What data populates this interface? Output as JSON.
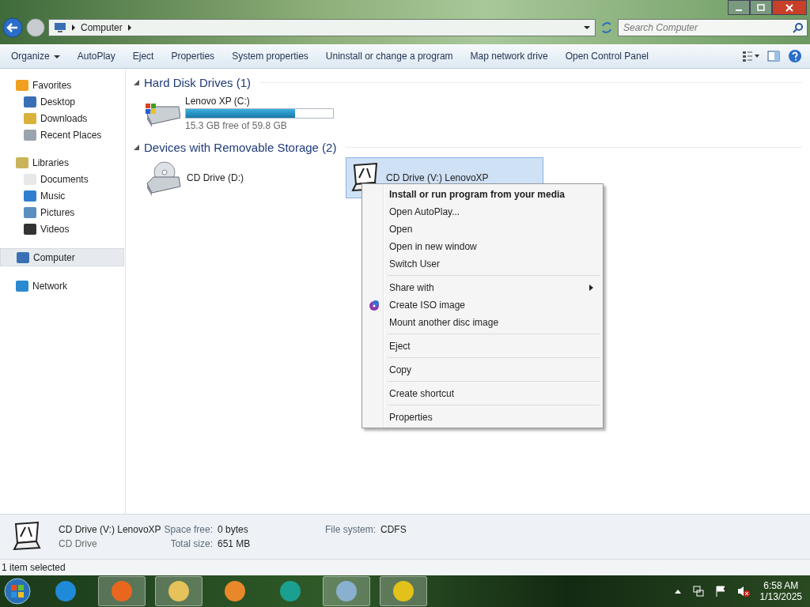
{
  "address_bar": {
    "path": "Computer"
  },
  "search": {
    "placeholder": "Search Computer"
  },
  "toolbar": {
    "items": [
      {
        "label": "Organize",
        "dropdown": true
      },
      {
        "label": "AutoPlay",
        "dropdown": false
      },
      {
        "label": "Eject",
        "dropdown": false
      },
      {
        "label": "Properties",
        "dropdown": false
      },
      {
        "label": "System properties",
        "dropdown": false
      },
      {
        "label": "Uninstall or change a program",
        "dropdown": false
      },
      {
        "label": "Map network drive",
        "dropdown": false
      },
      {
        "label": "Open Control Panel",
        "dropdown": false
      }
    ]
  },
  "sidebar": {
    "groups": [
      {
        "label": "Favorites",
        "kind": "star",
        "selected": false,
        "children": [
          {
            "label": "Desktop",
            "kind": "desktop"
          },
          {
            "label": "Downloads",
            "kind": "downloads"
          },
          {
            "label": "Recent Places",
            "kind": "recent"
          }
        ]
      },
      {
        "label": "Libraries",
        "kind": "library",
        "selected": false,
        "children": [
          {
            "label": "Documents",
            "kind": "documents"
          },
          {
            "label": "Music",
            "kind": "music"
          },
          {
            "label": "Pictures",
            "kind": "pictures"
          },
          {
            "label": "Videos",
            "kind": "videos"
          }
        ]
      },
      {
        "label": "Computer",
        "kind": "computer",
        "selected": true
      },
      {
        "label": "Network",
        "kind": "network",
        "selected": false
      }
    ]
  },
  "sections": [
    {
      "title": "Hard Disk Drives (1)",
      "drives": [
        {
          "kind": "hdd",
          "name": "Lenovo XP (C:)",
          "level": 0.74,
          "free": "15.3 GB free of 59.8 GB",
          "selected": false
        }
      ]
    },
    {
      "title": "Devices with Removable Storage (2)",
      "drives": [
        {
          "kind": "cd",
          "name": "CD Drive (D:)",
          "selected": false
        },
        {
          "kind": "xp",
          "name": "CD Drive (V:) LenovoXP",
          "selected": true
        }
      ]
    }
  ],
  "context_menu": {
    "items": [
      {
        "label": "Install or run program from your media",
        "bold": true,
        "separator_before": false,
        "submenu": false,
        "icon": false
      },
      {
        "label": "Open AutoPlay...",
        "bold": false,
        "separator_before": false,
        "submenu": false,
        "icon": false
      },
      {
        "label": "Open",
        "bold": false,
        "separator_before": false,
        "submenu": false,
        "icon": false
      },
      {
        "label": "Open in new window",
        "bold": false,
        "separator_before": false,
        "submenu": false,
        "icon": false
      },
      {
        "label": "Switch User",
        "bold": false,
        "separator_before": false,
        "submenu": false,
        "icon": false
      },
      {
        "label": "Share with",
        "bold": false,
        "separator_before": true,
        "submenu": true,
        "icon": false
      },
      {
        "label": "Create ISO image",
        "bold": false,
        "separator_before": false,
        "submenu": false,
        "icon": true
      },
      {
        "label": "Mount another disc image",
        "bold": false,
        "separator_before": false,
        "submenu": false,
        "icon": false
      },
      {
        "label": "Eject",
        "bold": false,
        "separator_before": true,
        "submenu": false,
        "icon": false
      },
      {
        "label": "Copy",
        "bold": false,
        "separator_before": true,
        "submenu": false,
        "icon": false
      },
      {
        "label": "Create shortcut",
        "bold": false,
        "separator_before": true,
        "submenu": false,
        "icon": false
      },
      {
        "label": "Properties",
        "bold": false,
        "separator_before": true,
        "submenu": false,
        "icon": false
      }
    ]
  },
  "details": {
    "name": "CD Drive (V:) LenovoXP",
    "type": "CD Drive",
    "fields": [
      {
        "label": "Space free:",
        "value": "0 bytes"
      },
      {
        "label": "Total size:",
        "value": "651 MB"
      },
      {
        "label": "File system:",
        "value": "CDFS"
      }
    ]
  },
  "status_bar": {
    "text": "1 item selected"
  },
  "taskbar": {
    "apps": [
      {
        "kind": "ie",
        "active": false
      },
      {
        "kind": "firefox",
        "active": true
      },
      {
        "kind": "explorer",
        "active": true
      },
      {
        "kind": "media",
        "active": false
      },
      {
        "kind": "globe",
        "active": false
      },
      {
        "kind": "paint",
        "active": true
      },
      {
        "kind": "disc",
        "active": true
      }
    ],
    "time": "6:58 AM",
    "date": "1/13/2025"
  }
}
